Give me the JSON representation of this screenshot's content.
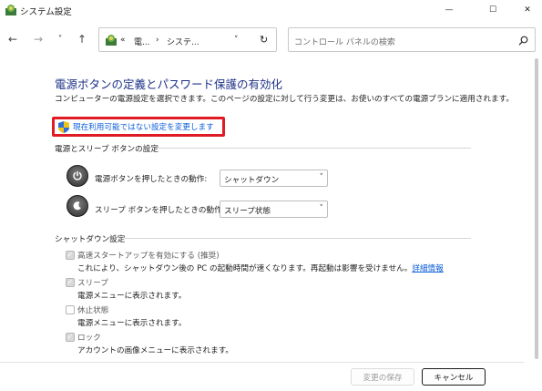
{
  "window": {
    "title": "システム設定",
    "minimize_glyph": "—",
    "maximize_glyph": "☐",
    "close_glyph": "✕"
  },
  "nav": {
    "back": "←",
    "forward": "→",
    "history": "˅",
    "up": "↑",
    "address": {
      "overflow": "«",
      "segment1": "電...",
      "arrow": "›",
      "segment2": "システ...",
      "dropdown": "˅",
      "refresh": "↻"
    },
    "search": {
      "placeholder": "コントロール パネルの検索",
      "icon": "search-icon"
    }
  },
  "content": {
    "title": "電源ボタンの定義とパスワード保護の有効化",
    "description": "コンピューターの電源設定を選択できます。このページの設定に対して行う変更は、お使いのすべての電源プランに適用されます。",
    "change_link": "現在利用可能ではない設定を変更します"
  },
  "power_section": {
    "heading": "電源とスリープ ボタンの設定",
    "rows": [
      {
        "label": "電源ボタンを押したときの動作:",
        "value": "シャットダウン"
      },
      {
        "label": "スリープ ボタンを押したときの動作:",
        "value": "スリープ状態"
      }
    ]
  },
  "shutdown_section": {
    "heading": "シャットダウン設定",
    "items": [
      {
        "label": "高速スタートアップを有効にする (推奨)",
        "checked": true,
        "disabled": true,
        "desc": "これにより、シャットダウン後の PC の起動時間が速くなります。再起動は影響を受けません。",
        "link": "詳細情報"
      },
      {
        "label": "スリープ",
        "checked": true,
        "disabled": true,
        "desc": "電源メニューに表示されます。"
      },
      {
        "label": "休止状態",
        "checked": false,
        "disabled": true,
        "desc": "電源メニューに表示されます。"
      },
      {
        "label": "ロック",
        "checked": true,
        "disabled": true,
        "desc": "アカウントの画像メニューに表示されます。"
      }
    ]
  },
  "footer": {
    "save": "変更の保存",
    "cancel": "キャンセル"
  },
  "colors": {
    "title_blue": "#1e3287",
    "link_blue": "#0b5ed7",
    "highlight_red": "#e01b24"
  }
}
